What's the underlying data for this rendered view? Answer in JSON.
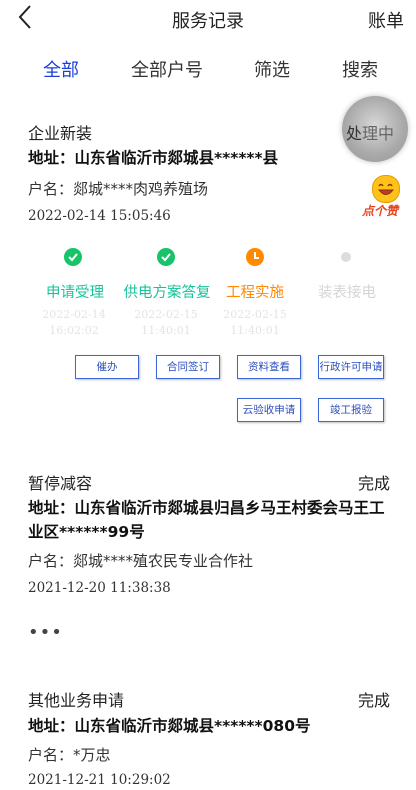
{
  "header": {
    "title": "服务记录",
    "right_action": "账单"
  },
  "tabs": [
    {
      "label": "全部",
      "active": true
    },
    {
      "label": "全部户号",
      "active": false
    },
    {
      "label": "筛选",
      "active": false
    },
    {
      "label": "搜索",
      "active": false
    }
  ],
  "records": [
    {
      "type": "企业新装",
      "status_main": "处",
      "status_rest": "理中",
      "address": "地址：山东省临沂市郯城县******县",
      "owner": "户名：郯城****肉鸡养殖场",
      "time": "2022-02-14 15:05:46",
      "like_label": "点个赞",
      "steps": [
        {
          "label": "申请受理",
          "state": "done",
          "date1": "2022-02-14",
          "date2": "16:02:02"
        },
        {
          "label": "供电方案答复",
          "state": "done",
          "date1": "2022-02-15",
          "date2": "11:40:01"
        },
        {
          "label": "工程实施",
          "state": "doing",
          "date1": "2022-02-15",
          "date2": "11:40:01"
        },
        {
          "label": "装表接电",
          "state": "todo",
          "date1": "",
          "date2": ""
        }
      ],
      "actions": [
        "催办",
        "合同签订",
        "资料查看",
        "行政许可申请",
        "云验收申请",
        "竣工报验"
      ]
    },
    {
      "type": "暂停减容",
      "status": "完成",
      "address": "地址：山东省临沂市郯城县归昌乡马王村委会马王工业区******99号",
      "owner": "户名：郯城****殖农民专业合作社",
      "time": "2021-12-20 11:38:38",
      "more": "•••"
    },
    {
      "type": "其他业务申请",
      "status": "完成",
      "address": "地址：山东省临沂市郯城县******080号",
      "owner": "户名：*万忠",
      "time": "2021-12-21 10:29:02"
    }
  ],
  "colors": {
    "accent": "#1a3fd8",
    "done": "#19c36a",
    "doing": "#ff8a00",
    "todo": "#dddddd"
  }
}
